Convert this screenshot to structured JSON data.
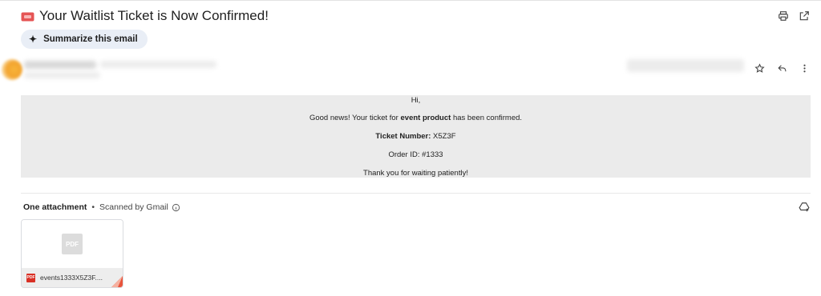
{
  "email": {
    "subject": "Your Waitlist Ticket is Now Confirmed!",
    "summarize_label": "Summarize this email"
  },
  "body": {
    "greeting": "Hi,",
    "line1_prefix": "Good news! Your ticket for ",
    "line1_bold": "event product",
    "line1_suffix": " has been confirmed.",
    "ticket_label": "Ticket Number:",
    "ticket_value": " X5Z3F",
    "order": "Order ID: #1333",
    "thanks": "Thank you for waiting patiently!"
  },
  "attachments": {
    "title": "One attachment",
    "separator": "•",
    "scanned": "Scanned by Gmail",
    "file": {
      "name": "events1333X5Z3F....",
      "type": "PDF"
    }
  },
  "icons": {
    "subject": "ticket-icon",
    "top_actions": [
      "print-icon",
      "open-in-new-window-icon"
    ],
    "message_actions": [
      "star-icon",
      "reply-icon",
      "more-vert-icon"
    ],
    "attachment_info": "info-icon",
    "drive": "add-to-drive-icon"
  },
  "colors": {
    "ticket_red": "#e55454",
    "summarize_bg": "#e9eef6",
    "body_bg": "#ebebeb",
    "pdf_red": "#d93025"
  }
}
